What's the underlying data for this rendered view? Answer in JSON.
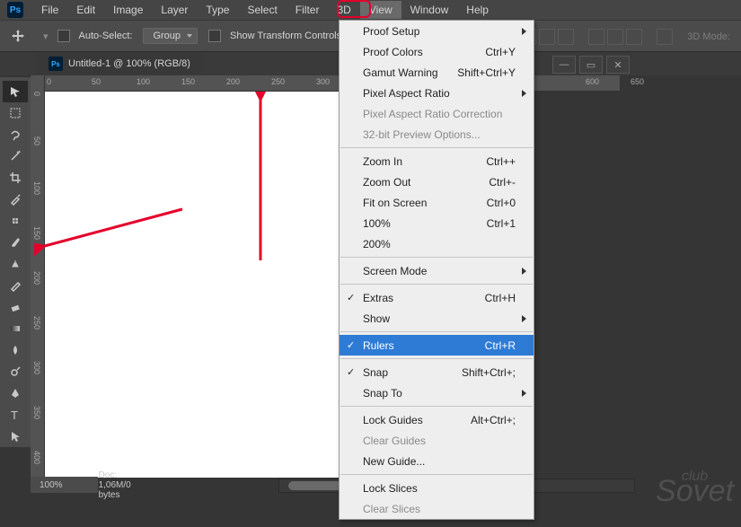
{
  "menubar": {
    "items": [
      "File",
      "Edit",
      "Image",
      "Layer",
      "Type",
      "Select",
      "Filter",
      "3D",
      "View",
      "Window",
      "Help"
    ],
    "active_index": 8
  },
  "options": {
    "auto_select": "Auto-Select:",
    "group": "Group",
    "show_transform": "Show Transform Controls",
    "mode3d": "3D Mode:"
  },
  "doc": {
    "title": "Untitled-1 @ 100% (RGB/8)"
  },
  "view_menu": {
    "items": [
      {
        "label": "Proof Setup",
        "sub": true
      },
      {
        "label": "Proof Colors",
        "short": "Ctrl+Y"
      },
      {
        "label": "Gamut Warning",
        "short": "Shift+Ctrl+Y"
      },
      {
        "label": "Pixel Aspect Ratio",
        "sub": true
      },
      {
        "label": "Pixel Aspect Ratio Correction",
        "disabled": true
      },
      {
        "label": "32-bit Preview Options...",
        "disabled": true
      },
      {
        "sep": true
      },
      {
        "label": "Zoom In",
        "short": "Ctrl++"
      },
      {
        "label": "Zoom Out",
        "short": "Ctrl+-"
      },
      {
        "label": "Fit on Screen",
        "short": "Ctrl+0"
      },
      {
        "label": "100%",
        "short": "Ctrl+1"
      },
      {
        "label": "200%"
      },
      {
        "sep": true
      },
      {
        "label": "Screen Mode",
        "sub": true
      },
      {
        "sep": true
      },
      {
        "label": "Extras",
        "short": "Ctrl+H",
        "check": true
      },
      {
        "label": "Show",
        "sub": true
      },
      {
        "sep": true
      },
      {
        "label": "Rulers",
        "short": "Ctrl+R",
        "check": true,
        "highlighted": true
      },
      {
        "sep": true
      },
      {
        "label": "Snap",
        "short": "Shift+Ctrl+;",
        "check": true
      },
      {
        "label": "Snap To",
        "sub": true
      },
      {
        "sep": true
      },
      {
        "label": "Lock Guides",
        "short": "Alt+Ctrl+;"
      },
      {
        "label": "Clear Guides",
        "disabled": true
      },
      {
        "label": "New Guide..."
      },
      {
        "sep": true
      },
      {
        "label": "Lock Slices"
      },
      {
        "label": "Clear Slices",
        "disabled": true
      }
    ]
  },
  "ruler_h": [
    0,
    50,
    100,
    150,
    200,
    250,
    300,
    600,
    650
  ],
  "ruler_v": [
    0,
    50,
    100,
    150,
    200,
    250,
    300,
    350,
    400
  ],
  "status": {
    "zoom": "100%",
    "doc": "Doc: 1,06M/0 bytes"
  },
  "watermark": {
    "club": "club",
    "name": "Sovet"
  }
}
